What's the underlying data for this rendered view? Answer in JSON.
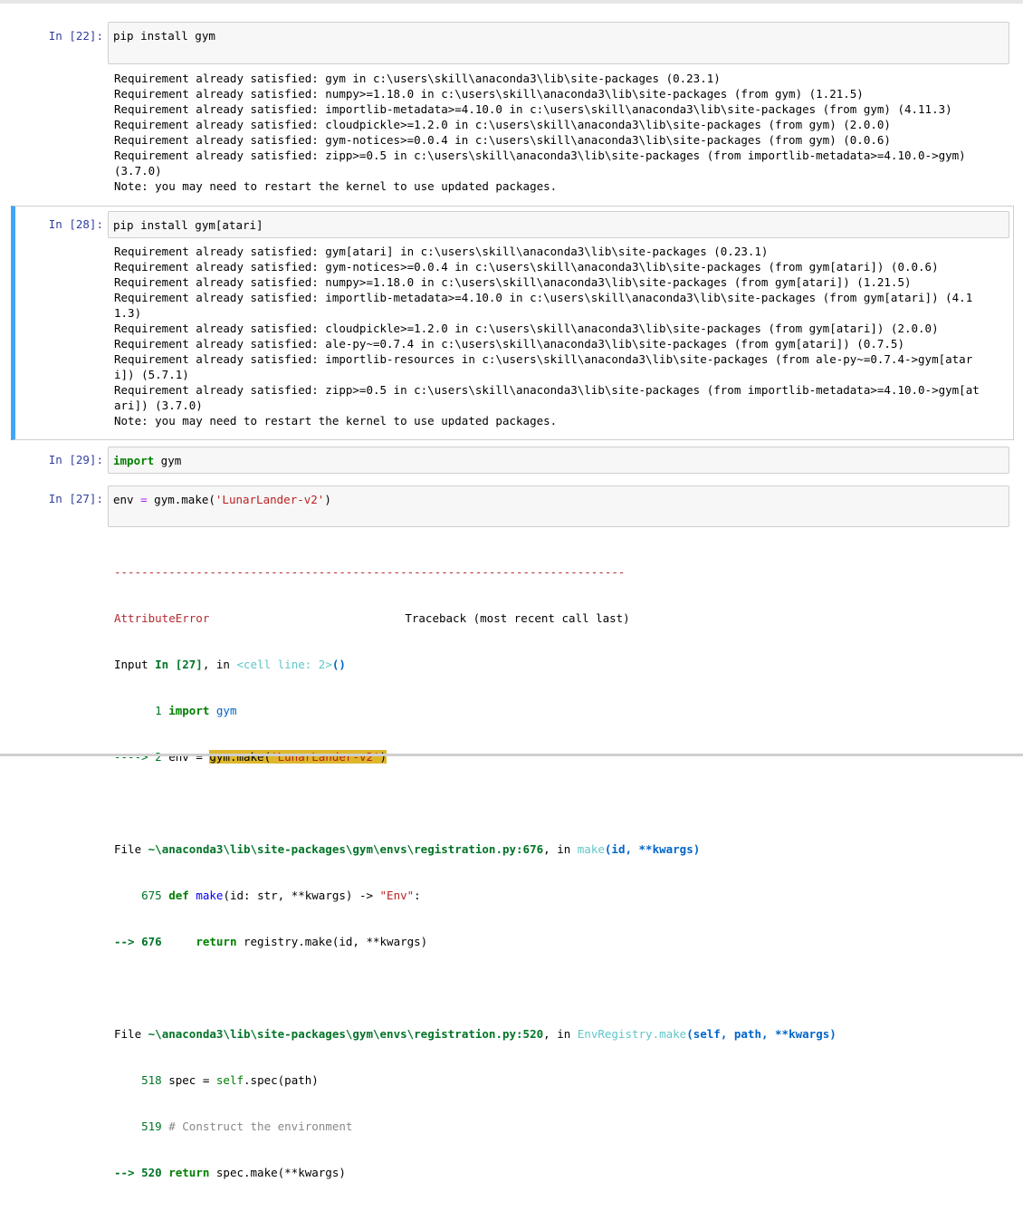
{
  "cells": [
    {
      "prompt": "In [22]:",
      "code": "pip install gym",
      "output": [
        "Requirement already satisfied: gym in c:\\users\\skill\\anaconda3\\lib\\site-packages (0.23.1)",
        "Requirement already satisfied: numpy>=1.18.0 in c:\\users\\skill\\anaconda3\\lib\\site-packages (from gym) (1.21.5)",
        "Requirement already satisfied: importlib-metadata>=4.10.0 in c:\\users\\skill\\anaconda3\\lib\\site-packages (from gym) (4.11.3)",
        "Requirement already satisfied: cloudpickle>=1.2.0 in c:\\users\\skill\\anaconda3\\lib\\site-packages (from gym) (2.0.0)",
        "Requirement already satisfied: gym-notices>=0.0.4 in c:\\users\\skill\\anaconda3\\lib\\site-packages (from gym) (0.0.6)",
        "Requirement already satisfied: zipp>=0.5 in c:\\users\\skill\\anaconda3\\lib\\site-packages (from importlib-metadata>=4.10.0->gym)",
        "(3.7.0)",
        "Note: you may need to restart the kernel to use updated packages."
      ]
    },
    {
      "prompt": "In [28]:",
      "code": "pip install gym[atari]",
      "output": [
        "Requirement already satisfied: gym[atari] in c:\\users\\skill\\anaconda3\\lib\\site-packages (0.23.1)",
        "Requirement already satisfied: gym-notices>=0.0.4 in c:\\users\\skill\\anaconda3\\lib\\site-packages (from gym[atari]) (0.0.6)",
        "Requirement already satisfied: numpy>=1.18.0 in c:\\users\\skill\\anaconda3\\lib\\site-packages (from gym[atari]) (1.21.5)",
        "Requirement already satisfied: importlib-metadata>=4.10.0 in c:\\users\\skill\\anaconda3\\lib\\site-packages (from gym[atari]) (4.1",
        "1.3)",
        "Requirement already satisfied: cloudpickle>=1.2.0 in c:\\users\\skill\\anaconda3\\lib\\site-packages (from gym[atari]) (2.0.0)",
        "Requirement already satisfied: ale-py~=0.7.4 in c:\\users\\skill\\anaconda3\\lib\\site-packages (from gym[atari]) (0.7.5)",
        "Requirement already satisfied: importlib-resources in c:\\users\\skill\\anaconda3\\lib\\site-packages (from ale-py~=0.7.4->gym[atar",
        "i]) (5.7.1)",
        "Requirement already satisfied: zipp>=0.5 in c:\\users\\skill\\anaconda3\\lib\\site-packages (from importlib-metadata>=4.10.0->gym[at",
        "ari]) (3.7.0)",
        "Note: you may need to restart the kernel to use updated packages."
      ]
    },
    {
      "prompt": "In [29]:",
      "code_kw": "import",
      "code_rest": " gym"
    },
    {
      "prompt": "In [27]:",
      "code_pre": "env ",
      "code_eq": "=",
      "code_mid": " gym.make(",
      "code_str": "'LunarLander-v2'",
      "code_post": ")"
    }
  ],
  "traceback": {
    "dashes": "---------------------------------------------------------------------------",
    "error_name": "AttributeError",
    "traceback_header": "Traceback (most recent call last)",
    "input_label": "Input ",
    "input_ref": "In [27]",
    "input_in": ", in ",
    "cell_line": "<cell line: 2>",
    "cell_paren": "()",
    "l1_num": "      1 ",
    "l1_kw": "import",
    "l1_rest": " gym",
    "l2_arrow": "----> 2 ",
    "l2_pre": "env = ",
    "l2_hl_a": "gym.make(",
    "l2_hl_str": "'LunarLander-v2'",
    "l2_hl_b": ")",
    "f1_file_a": "File ",
    "f1_path": "~\\anaconda3\\lib\\site-packages\\gym\\envs\\registration.py:676",
    "f1_in": ", in ",
    "f1_func": "make",
    "f1_args": "(id, **kwargs)",
    "f1_l675_num": "    675 ",
    "f1_l675_kw": "def",
    "f1_l675_name": " make",
    "f1_l675_rest": "(id: str, **kwargs) -> ",
    "f1_l675_str": "\"Env\"",
    "f1_l675_colon": ":",
    "f1_l676_arrow": "--> 676 ",
    "f1_l676_kw": "    return",
    "f1_l676_rest": " registry.make(id, **kwargs)",
    "f2_file_a": "File ",
    "f2_path": "~\\anaconda3\\lib\\site-packages\\gym\\envs\\registration.py:520",
    "f2_in": ", in ",
    "f2_func": "EnvRegistry.make",
    "f2_args": "(self, path, **kwargs)",
    "f2_l518_num": "    518 ",
    "f2_l518_pre": "spec = ",
    "f2_l518_self": "self",
    "f2_l518_rest": ".spec(path)",
    "f2_l519_num": "    519 ",
    "f2_l519_comment": "# Construct the environment",
    "f2_l520_arrow": "--> 520 ",
    "f2_l520_kw": "return",
    "f2_l520_rest": " spec.make(**kwargs)"
  }
}
